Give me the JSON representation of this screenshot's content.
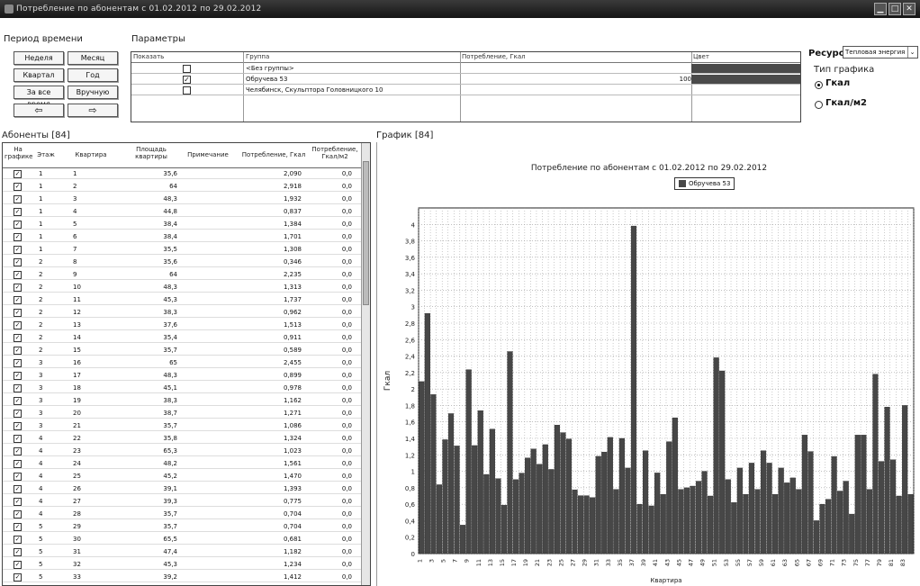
{
  "window": {
    "title": "Потребление по абонентам с 01.02.2012 по 29.02.2012"
  },
  "period": {
    "label": "Период времени",
    "buttons": [
      "Неделя",
      "Месяц",
      "Квартал",
      "Год",
      "За все время",
      "Вручную"
    ],
    "nav": [
      "⇦",
      "⇨"
    ]
  },
  "params": {
    "label": "Параметры",
    "headers": [
      "Показать",
      "Группа",
      "Потребление, Гкал",
      "Цвет"
    ],
    "rows": [
      {
        "checked": false,
        "group": "<Без группы>",
        "consumption": "",
        "color": "#4a4a4a"
      },
      {
        "checked": true,
        "group": "Обручева 53",
        "consumption": "100",
        "color": "#4a4a4a"
      },
      {
        "checked": false,
        "group": "Челябинск, Скульптора Головницкого 10",
        "consumption": "",
        "color": ""
      }
    ]
  },
  "resource": {
    "label": "Ресурс:",
    "value": "Тепловая энергия"
  },
  "chart_type": {
    "label": "Тип графика",
    "options": [
      {
        "label": "Гкал",
        "selected": true
      },
      {
        "label": "Гкал/м2",
        "selected": false
      }
    ]
  },
  "subscribers": {
    "label": "Абоненты [84]",
    "headers": [
      "На графике",
      "Этаж",
      "Квартира",
      "Площадь квартиры",
      "Примечание",
      "Потребление, Гкал",
      "Потребление, Гкал/м2"
    ],
    "rows": [
      [
        "1",
        "1",
        "35,6",
        "2,090",
        "0,0"
      ],
      [
        "1",
        "2",
        "64",
        "2,918",
        "0,0"
      ],
      [
        "1",
        "3",
        "48,3",
        "1,932",
        "0,0"
      ],
      [
        "1",
        "4",
        "44,8",
        "0,837",
        "0,0"
      ],
      [
        "1",
        "5",
        "38,4",
        "1,384",
        "0,0"
      ],
      [
        "1",
        "6",
        "38,4",
        "1,701",
        "0,0"
      ],
      [
        "1",
        "7",
        "35,5",
        "1,308",
        "0,0"
      ],
      [
        "2",
        "8",
        "35,6",
        "0,346",
        "0,0"
      ],
      [
        "2",
        "9",
        "64",
        "2,235",
        "0,0"
      ],
      [
        "2",
        "10",
        "48,3",
        "1,313",
        "0,0"
      ],
      [
        "2",
        "11",
        "45,3",
        "1,737",
        "0,0"
      ],
      [
        "2",
        "12",
        "38,3",
        "0,962",
        "0,0"
      ],
      [
        "2",
        "13",
        "37,6",
        "1,513",
        "0,0"
      ],
      [
        "2",
        "14",
        "35,4",
        "0,911",
        "0,0"
      ],
      [
        "2",
        "15",
        "35,7",
        "0,589",
        "0,0"
      ],
      [
        "3",
        "16",
        "65",
        "2,455",
        "0,0"
      ],
      [
        "3",
        "17",
        "48,3",
        "0,899",
        "0,0"
      ],
      [
        "3",
        "18",
        "45,1",
        "0,978",
        "0,0"
      ],
      [
        "3",
        "19",
        "38,3",
        "1,162",
        "0,0"
      ],
      [
        "3",
        "20",
        "38,7",
        "1,271",
        "0,0"
      ],
      [
        "3",
        "21",
        "35,7",
        "1,086",
        "0,0"
      ],
      [
        "4",
        "22",
        "35,8",
        "1,324",
        "0,0"
      ],
      [
        "4",
        "23",
        "65,3",
        "1,023",
        "0,0"
      ],
      [
        "4",
        "24",
        "48,2",
        "1,561",
        "0,0"
      ],
      [
        "4",
        "25",
        "45,2",
        "1,470",
        "0,0"
      ],
      [
        "4",
        "26",
        "39,1",
        "1,393",
        "0,0"
      ],
      [
        "4",
        "27",
        "39,3",
        "0,775",
        "0,0"
      ],
      [
        "4",
        "28",
        "35,7",
        "0,704",
        "0,0"
      ],
      [
        "5",
        "29",
        "35,7",
        "0,704",
        "0,0"
      ],
      [
        "5",
        "30",
        "65,5",
        "0,681",
        "0,0"
      ],
      [
        "5",
        "31",
        "47,4",
        "1,182",
        "0,0"
      ],
      [
        "5",
        "32",
        "45,3",
        "1,234",
        "0,0"
      ],
      [
        "5",
        "33",
        "39,2",
        "1,412",
        "0,0"
      ]
    ]
  },
  "chart_panel": {
    "label": "График [84]"
  },
  "chart_data": {
    "type": "bar",
    "title": "Потребление по абонентам с 01.02.2012 по 29.02.2012",
    "xlabel": "Квартира",
    "ylabel": "Гкал",
    "ylim": [
      0,
      4.2
    ],
    "yticks": [
      0,
      0.2,
      0.4,
      0.6,
      0.8,
      1,
      1.2,
      1.4,
      1.6,
      1.8,
      2,
      2.2,
      2.4,
      2.6,
      2.8,
      3,
      3.2,
      3.4,
      3.6,
      3.8,
      4
    ],
    "ytick_labels": [
      "0",
      "0,2",
      "0,4",
      "0,6",
      "0,8",
      "1",
      "1,2",
      "1,4",
      "1,6",
      "1,8",
      "2",
      "2,2",
      "2,4",
      "2,6",
      "2,8",
      "3",
      "3,2",
      "3,4",
      "3,6",
      "3,8",
      "4"
    ],
    "grid": true,
    "legend_position": "top-center",
    "bar_color": "#474747",
    "series": [
      {
        "name": "Обручева 53",
        "values": [
          2.09,
          2.918,
          1.932,
          0.837,
          1.384,
          1.701,
          1.308,
          0.346,
          2.235,
          1.313,
          1.737,
          0.962,
          1.513,
          0.911,
          0.589,
          2.455,
          0.899,
          0.978,
          1.162,
          1.271,
          1.086,
          1.324,
          1.023,
          1.561,
          1.47,
          1.393,
          0.775,
          0.704,
          0.704,
          0.681,
          1.182,
          1.234,
          1.412,
          0.78,
          1.4,
          1.04,
          3.98,
          0.6,
          1.25,
          0.58,
          0.98,
          0.72,
          1.36,
          1.65,
          0.78,
          0.8,
          0.82,
          0.88,
          1.0,
          0.7,
          2.38,
          2.22,
          0.9,
          0.62,
          1.04,
          0.72,
          1.1,
          0.78,
          1.25,
          1.1,
          0.72,
          1.04,
          0.86,
          0.92,
          0.78,
          1.44,
          1.24,
          0.4,
          0.6,
          0.66,
          1.18,
          0.76,
          0.88,
          0.48,
          1.44,
          1.44,
          0.78,
          2.18,
          1.12,
          1.78,
          1.14,
          0.7,
          1.8,
          0.72
        ]
      }
    ],
    "categories_labeled": [
      "1",
      "3",
      "5",
      "7",
      "9",
      "11",
      "13",
      "15",
      "17",
      "19",
      "21",
      "23",
      "25",
      "27",
      "29",
      "31",
      "33",
      "35",
      "37",
      "39",
      "41",
      "43",
      "45",
      "47",
      "49",
      "51",
      "53",
      "55",
      "57",
      "59",
      "61",
      "63",
      "65",
      "67",
      "69",
      "71",
      "73",
      "75",
      "77",
      "79",
      "81",
      "83"
    ]
  }
}
